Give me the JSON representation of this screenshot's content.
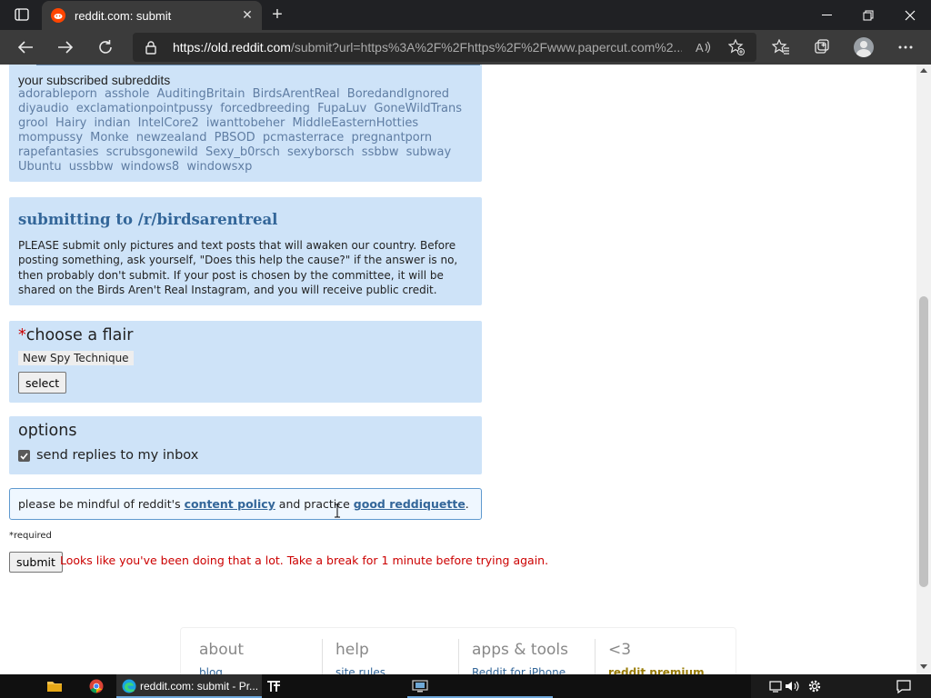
{
  "browser": {
    "tab_title": "reddit.com: submit",
    "url_host": "https://old.reddit.com",
    "url_rest": "/submit?url=https%3A%2F%2Fhttps%2F%2Fwww.papercut.com%2..."
  },
  "subscribed": {
    "heading": "your subscribed subreddits",
    "items": [
      "adorableporn",
      "asshole",
      "AuditingBritain",
      "BirdsArentReal",
      "BoredandIgnored",
      "diyaudio",
      "exclamationpointpussy",
      "forcedbreeding",
      "FupaLuv",
      "GoneWildTrans",
      "grool",
      "Hairy",
      "indian",
      "IntelCore2",
      "iwanttobeher",
      "MiddleEasternHotties",
      "mompussy",
      "Monke",
      "newzealand",
      "PBSOD",
      "pcmasterrace",
      "pregnantporn",
      "rapefantasies",
      "scrubsgonewild",
      "Sexy_b0rsch",
      "sexyborsch",
      "ssbbw",
      "subway",
      "Ubuntu",
      "ussbbw",
      "windows8",
      "windowsxp"
    ]
  },
  "submitting": {
    "title": "submitting to /r/birdsarentreal",
    "text": "PLEASE submit only pictures and text posts that will awaken our country. Before posting something, ask yourself, \"Does this help the cause?\" if the answer is no, then probably don't submit. If your post is chosen by the committee, it will be shared on the Birds Aren't Real Instagram, and you will receive public credit."
  },
  "flair": {
    "required_mark": "*",
    "title": "choose a flair",
    "selected": "New Spy Technique",
    "select_label": "select"
  },
  "options": {
    "title": "options",
    "send_replies_label": "send replies to my inbox",
    "send_replies_checked": true
  },
  "policy": {
    "prefix": "please be mindful of reddit's ",
    "link1": "content policy",
    "middle": " and practice ",
    "link2": "good reddiquette",
    "suffix": "."
  },
  "form": {
    "required_note": "*required",
    "submit_label": "submit",
    "error": "Looks like you've been doing that a lot. Take a break for 1 minute before trying again."
  },
  "footer": {
    "columns": [
      {
        "heading": "about",
        "first_link": "blog"
      },
      {
        "heading": "help",
        "first_link": "site rules"
      },
      {
        "heading": "apps & tools",
        "first_link": "Reddit for iPhone"
      },
      {
        "heading": "<3",
        "first_link": "reddit premium"
      }
    ]
  },
  "taskbar": {
    "active_label": "reddit.com: submit - Pr..."
  },
  "colors": {
    "box_bg": "#cee3f8",
    "link_blue": "#336699",
    "error_red": "#cc0000",
    "reddit_orange": "#ff4500"
  }
}
